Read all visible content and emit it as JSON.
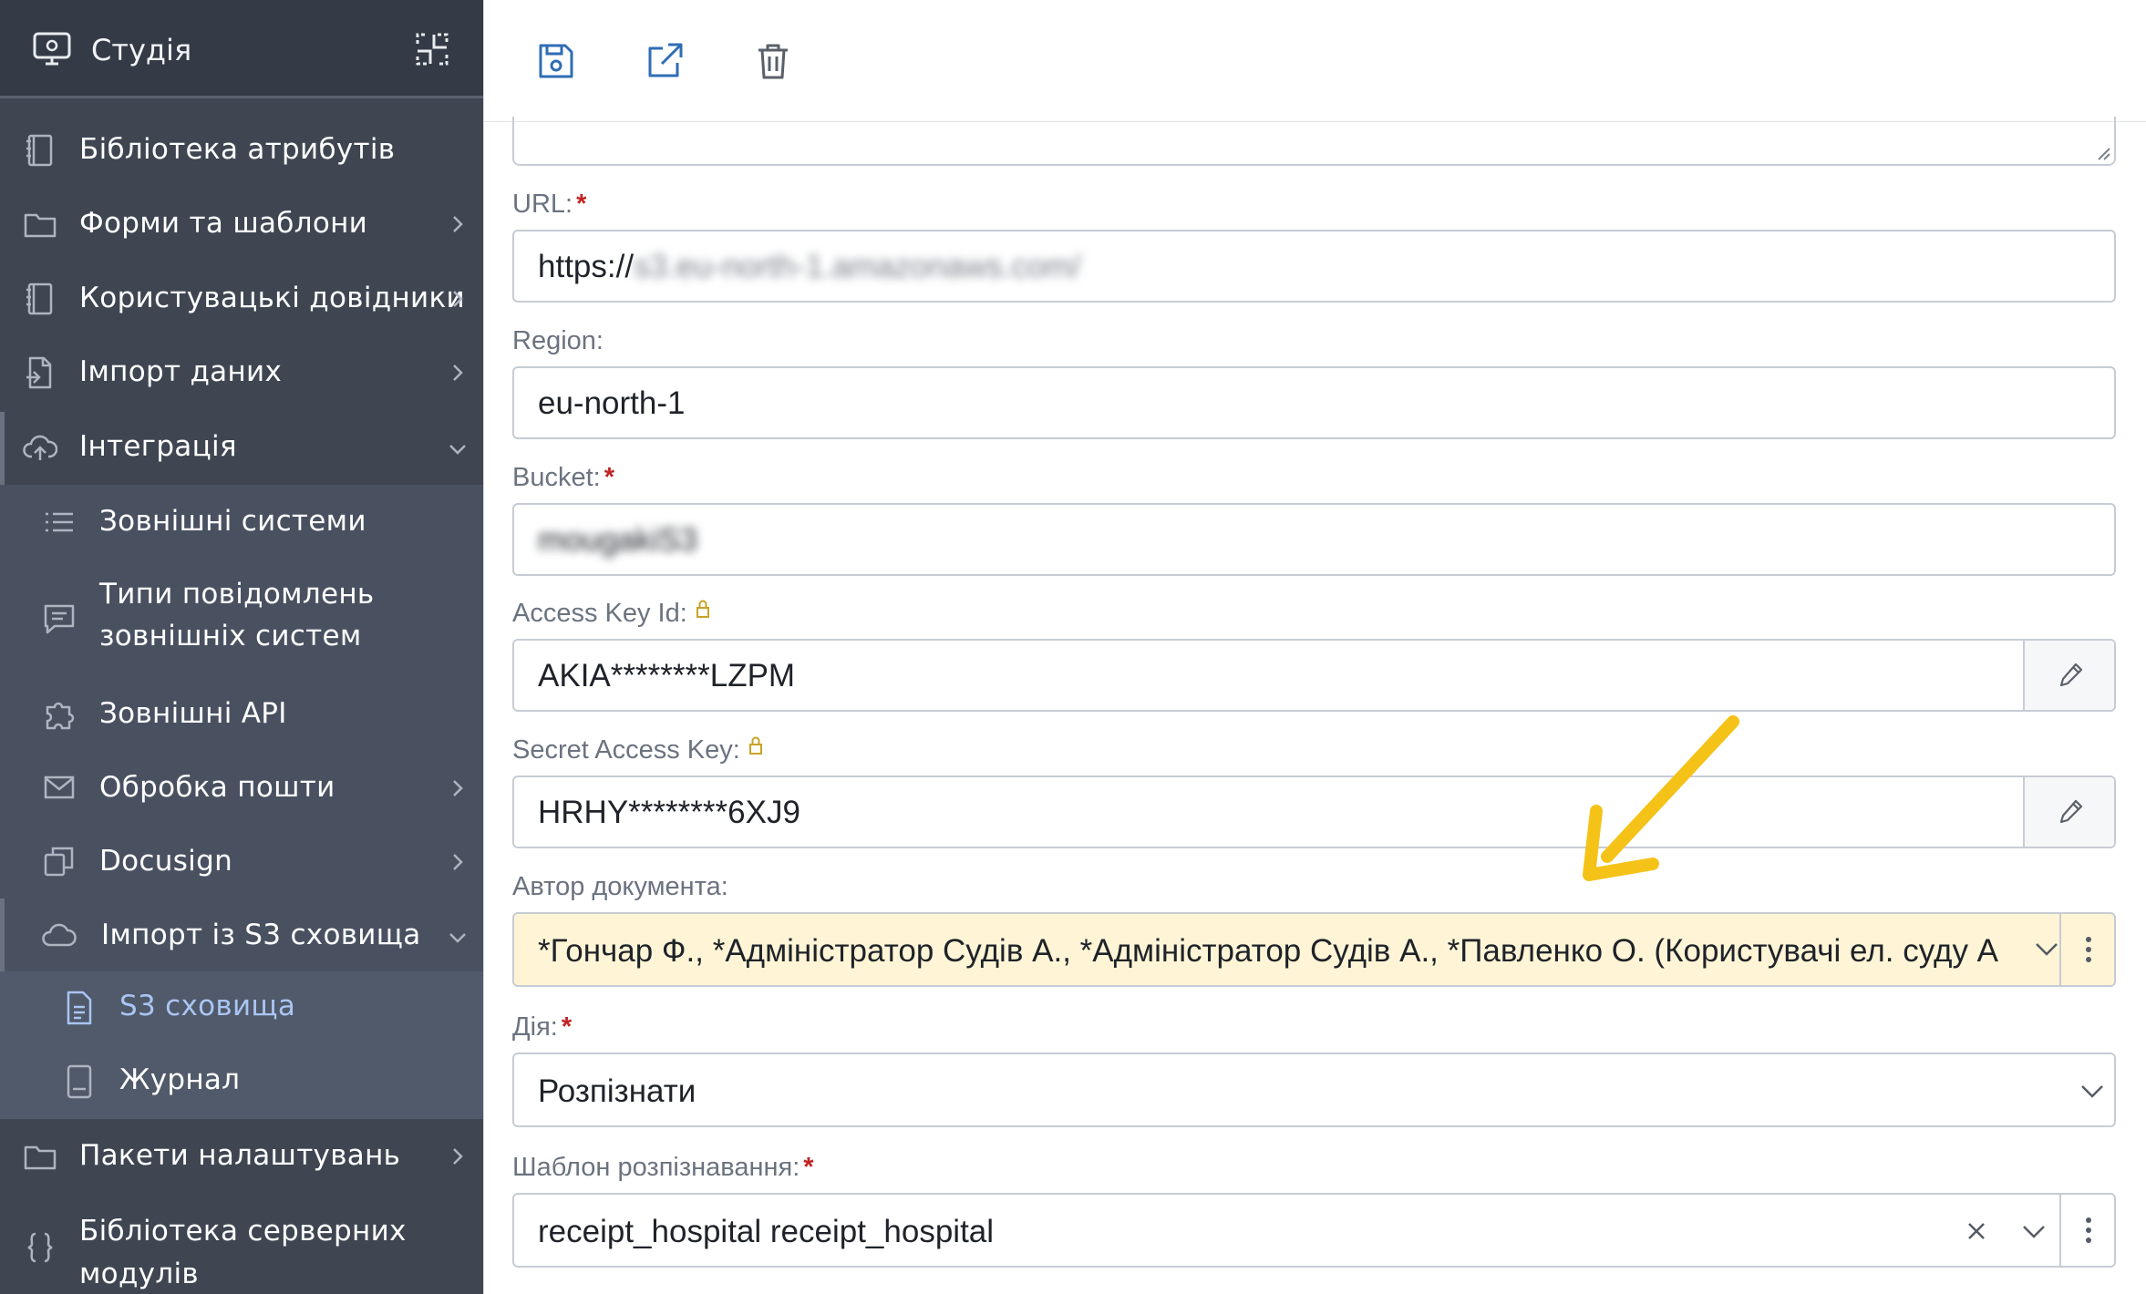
{
  "sidebar": {
    "title": "Студія",
    "items": [
      {
        "label": "Бібліотека атрибутів",
        "icon": "book-icon"
      },
      {
        "label": "Форми та шаблони",
        "icon": "folder-icon"
      },
      {
        "label": "Користувацькі довідники",
        "icon": "book-icon"
      },
      {
        "label": "Імпорт даних",
        "icon": "file-import-icon"
      },
      {
        "label": "Інтеграція",
        "icon": "cloud-upload-icon"
      },
      {
        "label": "Пакети налаштувань",
        "icon": "folder-icon"
      },
      {
        "label": "Бібліотека серверних модулів",
        "icon": "braces-icon"
      }
    ],
    "integration_items": [
      {
        "label": "Зовнішні системи",
        "icon": "list-icon"
      },
      {
        "label": "Типи повідомлень зовнішніх систем",
        "icon": "message-icon"
      },
      {
        "label": "Зовнішні API",
        "icon": "puzzle-icon"
      },
      {
        "label": "Обробка пошти",
        "icon": "mail-icon"
      },
      {
        "label": "Docusign",
        "icon": "docusign-icon"
      },
      {
        "label": "Імпорт із S3 сховища",
        "icon": "cloud-icon"
      }
    ],
    "s3_items": [
      {
        "label": "S3 сховища",
        "icon": "document-icon",
        "active": true
      },
      {
        "label": "Журнал",
        "icon": "journal-icon",
        "active": false
      }
    ]
  },
  "toolbar": {
    "buttons": [
      "save-icon",
      "open-external-icon",
      "delete-icon"
    ]
  },
  "form": {
    "url": {
      "label": "URL:",
      "required": "*",
      "prefix": "https://",
      "hidden_value": "s3.eu-north-1.amazonaws.com/"
    },
    "region": {
      "label": "Region:",
      "value": "eu-north-1"
    },
    "bucket": {
      "label": "Bucket:",
      "required": "*",
      "hidden_value": "mougakiS3"
    },
    "access_key": {
      "label": "Access Key Id:",
      "value": "AKIA********LZPM"
    },
    "secret_key": {
      "label": "Secret Access Key:",
      "value": "HRHY********6XJ9"
    },
    "author": {
      "label": "Автор документа:",
      "value": "*Гончар Ф., *Адміністратор Судів А., *Адміністратор Судів А., *Павленко О. (Користувачі ел. суду А"
    },
    "action": {
      "label": "Дія:",
      "required": "*",
      "value": "Розпізнати"
    },
    "template": {
      "label": "Шаблон розпізнавання:",
      "required": "*",
      "value": "receipt_hospital receipt_hospital"
    }
  },
  "colors": {
    "sidebar_bg": "#3f4652",
    "active_link": "#a9c5f3",
    "accent_blue": "#2f6db5",
    "highlight_yellow": "#fff5d6",
    "arrow_yellow": "#f5c218",
    "required_red": "#c02323"
  }
}
